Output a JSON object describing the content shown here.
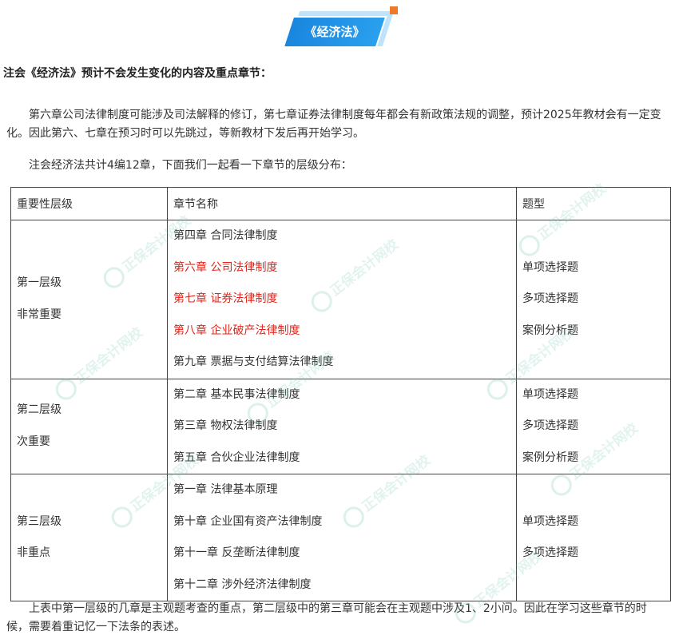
{
  "banner": {
    "title": "《经济法》"
  },
  "section_title": "注会《经济法》预计不会发生变化的内容及重点章节：",
  "paragraphs": {
    "intro": "第六章公司法律制度可能涉及司法解释的修订，第七章证券法律制度每年都会有新政策法规的调整，预计2025年教材会有一定变化。因此第六、七章在预习时可以先跳过，等新教材下发后再开始学习。",
    "overview": "注会经济法共计4编12章，下面我们一起看一下章节的层级分布：",
    "conclusion": "上表中第一层级的几章是主观题考查的重点，第二层级中的第三章可能会在主观题中涉及1、2小问。因此在学习这些章节的时候，需要着重记忆一下法条的表述。"
  },
  "table": {
    "headers": [
      "重要性层级",
      "章节名称",
      "题型"
    ],
    "rows": [
      {
        "level": "第一层级",
        "importance": "非常重要",
        "chapters": [
          {
            "text": "第四章  合同法律制度",
            "red": false
          },
          {
            "text": "第六章  公司法律制度",
            "red": true
          },
          {
            "text": "第七章  证券法律制度",
            "red": true
          },
          {
            "text": "第八章  企业破产法律制度",
            "red": true
          },
          {
            "text": "第九章  票据与支付结算法律制度",
            "red": false
          }
        ],
        "types": [
          "",
          "单项选择题",
          "多项选择题",
          "案例分析题",
          ""
        ]
      },
      {
        "level": "第二层级",
        "importance": "次重要",
        "chapters": [
          {
            "text": "第二章  基本民事法律制度",
            "red": false
          },
          {
            "text": "第三章  物权法律制度",
            "red": false
          },
          {
            "text": "第五章  合伙企业法律制度",
            "red": false
          }
        ],
        "types": [
          "单项选择题",
          "多项选择题",
          "案例分析题"
        ]
      },
      {
        "level": "第三层级",
        "importance": "非重点",
        "chapters": [
          {
            "text": "第一章  法律基本原理",
            "red": false
          },
          {
            "text": "第十章  企业国有资产法律制度",
            "red": false
          },
          {
            "text": "第十一章  反垄断法律制度",
            "red": false
          },
          {
            "text": "第十二章  涉外经济法律制度",
            "red": false
          }
        ],
        "types": [
          "",
          "单项选择题",
          "多项选择题",
          ""
        ]
      }
    ]
  },
  "watermark": {
    "text": "正保会计网校"
  },
  "colors": {
    "banner_blue": "#1a86de",
    "banner_light": "#bfe3fb",
    "accent_orange": "#f0782a",
    "highlight_red": "#e0241b"
  }
}
